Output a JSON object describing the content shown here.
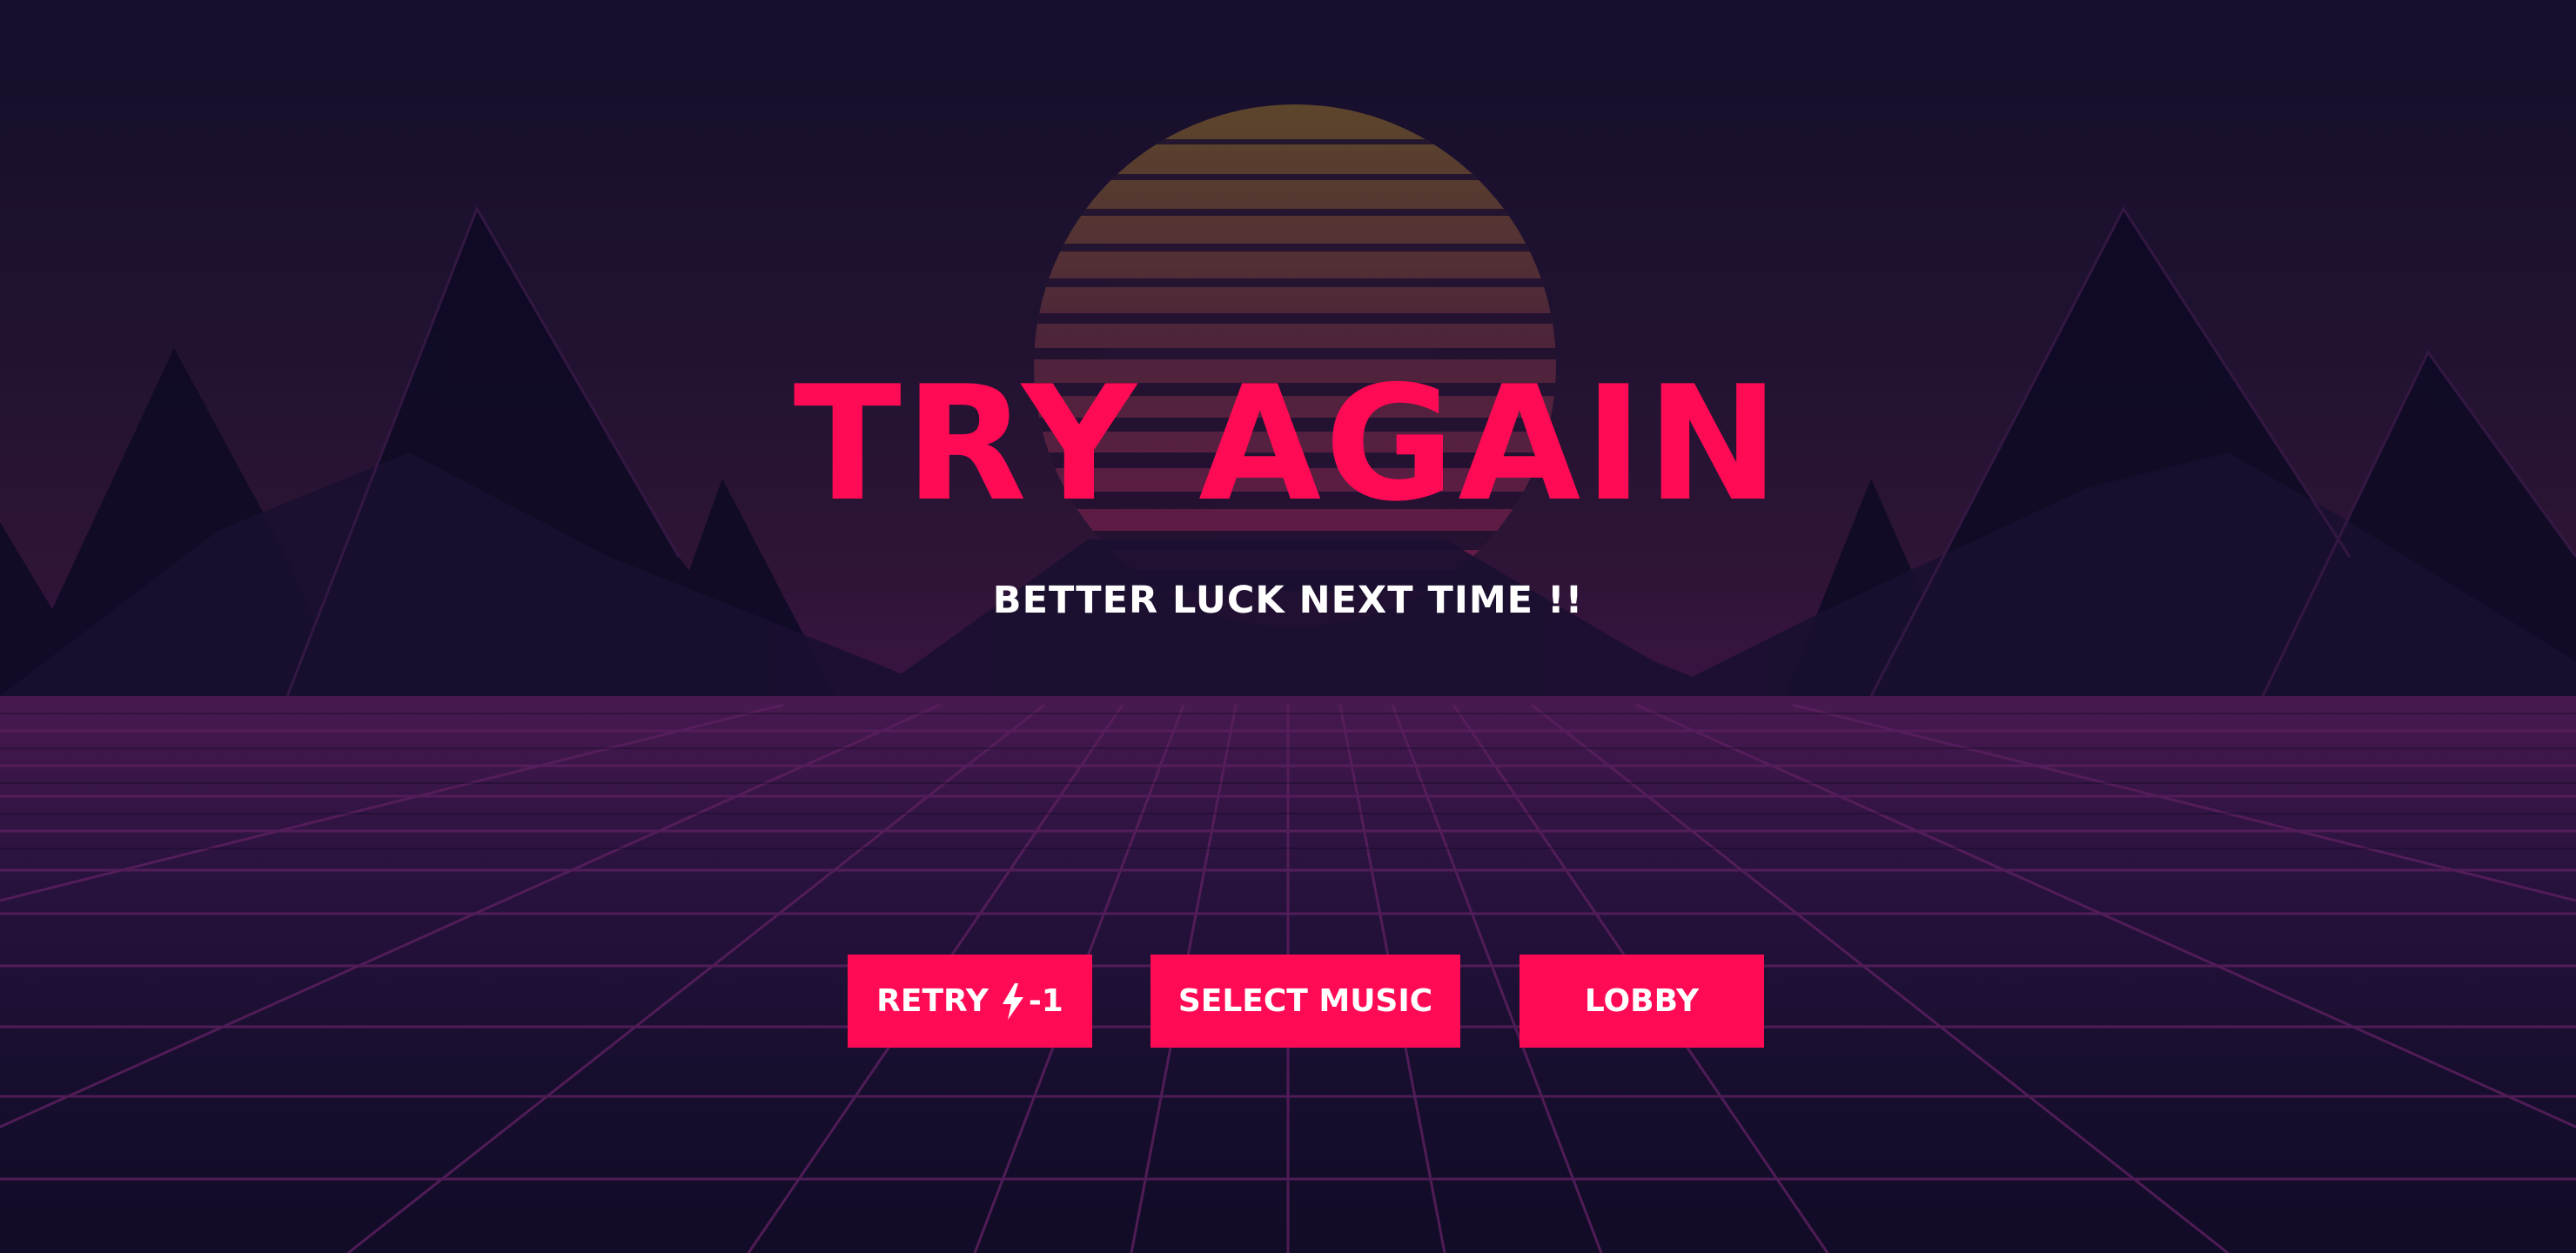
{
  "screen": {
    "title": "TRY AGAIN",
    "subtitle": "BETTER LUCK NEXT TIME !!"
  },
  "buttons": {
    "retry_label": "RETRY",
    "retry_icon": "lightning-bolt-icon",
    "retry_cost": "-1",
    "select_music_label": "SELECT MUSIC",
    "lobby_label": "LOBBY"
  },
  "theme": {
    "accent": "#ff0a54",
    "background": "#120c28",
    "grid_line": "#5a1f5e",
    "sun_top": "#c9a12e",
    "sun_bottom": "#e0147a",
    "mountain": "#100b26"
  }
}
